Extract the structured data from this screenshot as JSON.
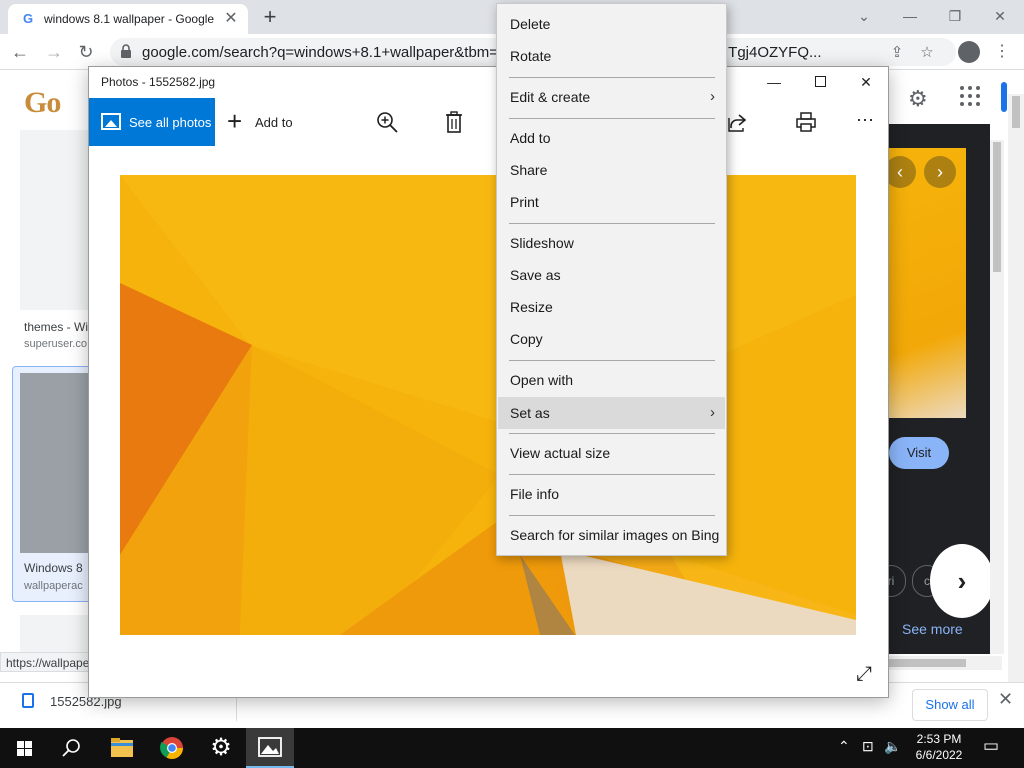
{
  "browser": {
    "tab_title": "windows 8.1 wallpaper - Google",
    "url": "google.com/search?q=windows+8.1+wallpaper&tbm=isch&ved=...#imgrc=...g_1:original:Tgj4OZYFQ...",
    "status_url": "https://wallpape"
  },
  "page": {
    "logo_text": "Go",
    "result1": {
      "title": "themes - Wi",
      "source": "superuser.co"
    },
    "result2": {
      "title": "Windows 8",
      "source": "wallpaperac"
    },
    "visit_label": "Visit",
    "see_more_label": "See more",
    "chip1": "ri",
    "chip2": "c"
  },
  "download_bar": {
    "filename": "1552582.jpg",
    "show_all_label": "Show all"
  },
  "photos": {
    "title": "Photos - 1552582.jpg",
    "see_all_label": "See all photos",
    "add_to_label": "Add to"
  },
  "context_menu": {
    "items": [
      {
        "label": "Delete"
      },
      {
        "label": "Rotate"
      },
      {
        "label": "Edit & create"
      },
      {
        "label": "Add to"
      },
      {
        "label": "Share"
      },
      {
        "label": "Print"
      },
      {
        "label": "Slideshow"
      },
      {
        "label": "Save as"
      },
      {
        "label": "Resize"
      },
      {
        "label": "Copy"
      },
      {
        "label": "Open with"
      },
      {
        "label": "Set as"
      },
      {
        "label": "View actual size"
      },
      {
        "label": "File info"
      },
      {
        "label": "Search for similar images on Bing"
      }
    ],
    "highlighted": "Set as"
  },
  "taskbar": {
    "time": "2:53 PM",
    "date": "6/6/2022"
  },
  "colors": {
    "accent": "#0078d7",
    "wallpaper_yellow": "#f6b30b",
    "wallpaper_orange": "#e8750f"
  }
}
